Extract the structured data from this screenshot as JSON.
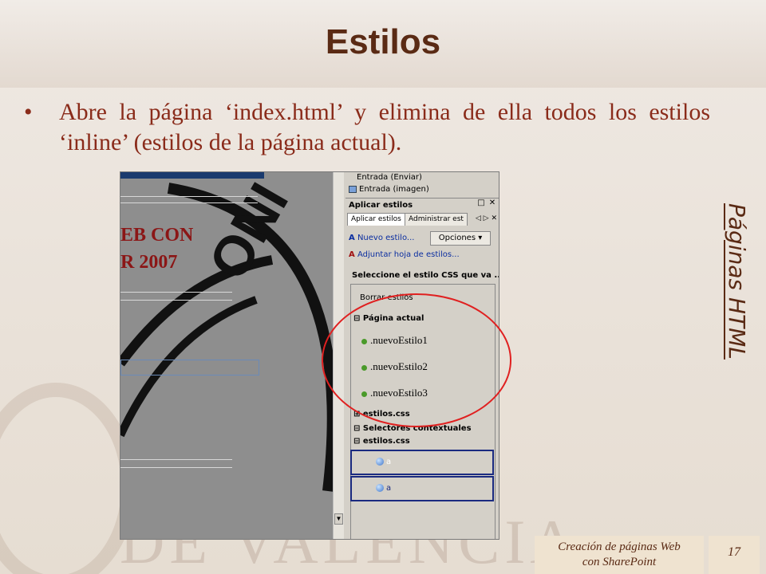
{
  "slide": {
    "title": "Estilos",
    "bullet": "Abre la página ‘index.html’ y elimina de ella todos los estilos ‘inline’ (estilos de la página actual).",
    "side_label": "Páginas HTML",
    "footer_line1": "Creación de páginas Web",
    "footer_line2": "con SharePoint",
    "page_number": "17",
    "watermark": "DE VALENCIA"
  },
  "screenshot": {
    "canvas": {
      "red_text_1": "EB CON",
      "red_text_2": "R 2007"
    },
    "toolbox": {
      "item_1": "Entrada (Enviar)",
      "item_2": "Entrada (imagen)"
    },
    "apply_styles": {
      "panel_title": "Aplicar estilos",
      "tabs": [
        "Aplicar estilos",
        "Administrar est"
      ],
      "new_style": "Nuevo estilo...",
      "options": "Opciones",
      "attach": "Adjuntar hoja de estilos...",
      "select_prompt": "Seleccione el estilo CSS que va ...",
      "clear_styles": "Borrar estilos",
      "group_current": "Página actual",
      "styles": [
        ".nuevoEstilo1",
        ".nuevoEstilo2",
        ".nuevoEstilo3"
      ],
      "group_css_1": "estilos.css",
      "group_selectors": "Selectores contextuales",
      "group_css_2": "estilos.css",
      "selectors": [
        "a",
        "a"
      ]
    }
  },
  "colors": {
    "title": "#5a2a14",
    "bullet": "#8a2b1a",
    "highlight_circle": "#e02020"
  }
}
